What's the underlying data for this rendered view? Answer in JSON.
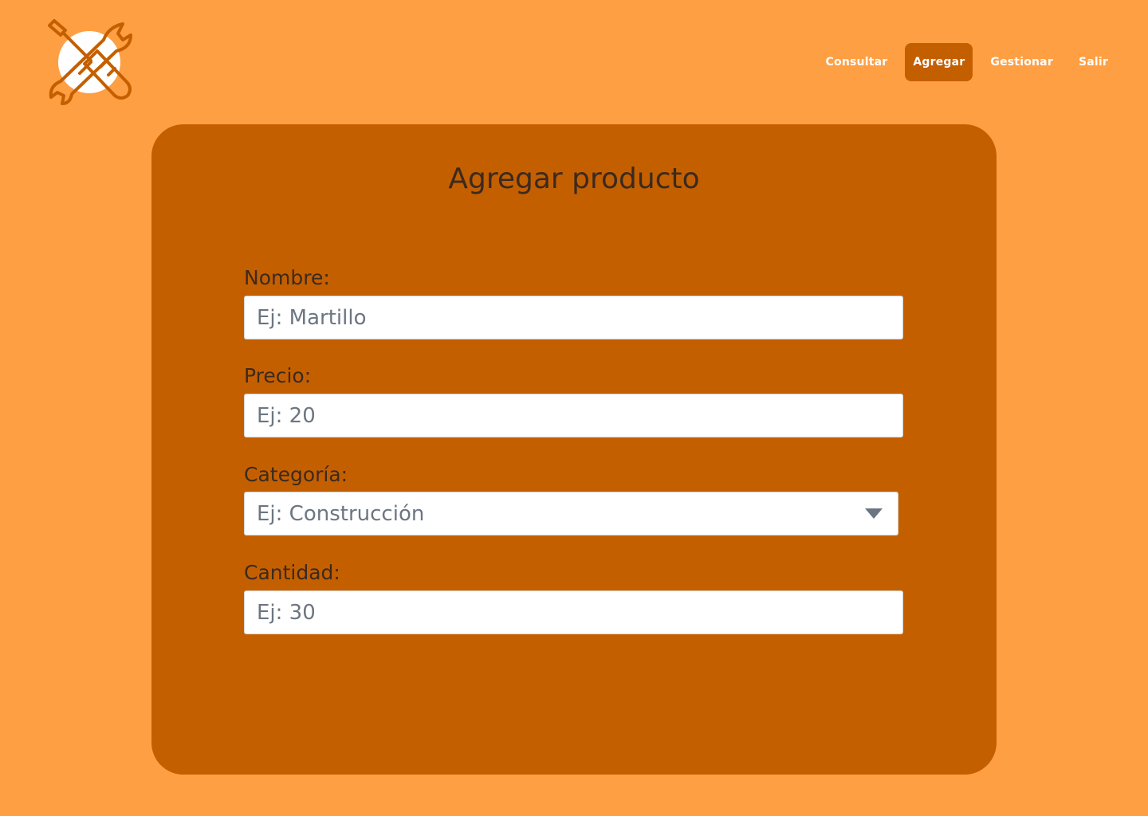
{
  "header": {
    "logo_icon": "tools-wrench-screwdriver-icon",
    "nav": [
      {
        "label": "Consultar",
        "active": false
      },
      {
        "label": "Agregar",
        "active": true
      },
      {
        "label": "Gestionar",
        "active": false
      },
      {
        "label": "Salir",
        "active": false
      }
    ]
  },
  "form": {
    "title": "Agregar producto",
    "fields": {
      "nombre": {
        "label": "Nombre:",
        "placeholder": "Ej: Martillo",
        "value": ""
      },
      "precio": {
        "label": "Precio:",
        "placeholder": "Ej: 20",
        "value": ""
      },
      "categoria": {
        "label": "Categoría:",
        "placeholder": "Ej: Construcción",
        "icon": "chevron-down-icon"
      },
      "cantidad": {
        "label": "Cantidad:",
        "placeholder": "Ej: 30",
        "value": ""
      }
    }
  },
  "colors": {
    "background": "#ff9f43",
    "card": "#c45f00",
    "accent": "#c45f00",
    "text": "#3b2a1f",
    "placeholder": "#6c7682"
  }
}
